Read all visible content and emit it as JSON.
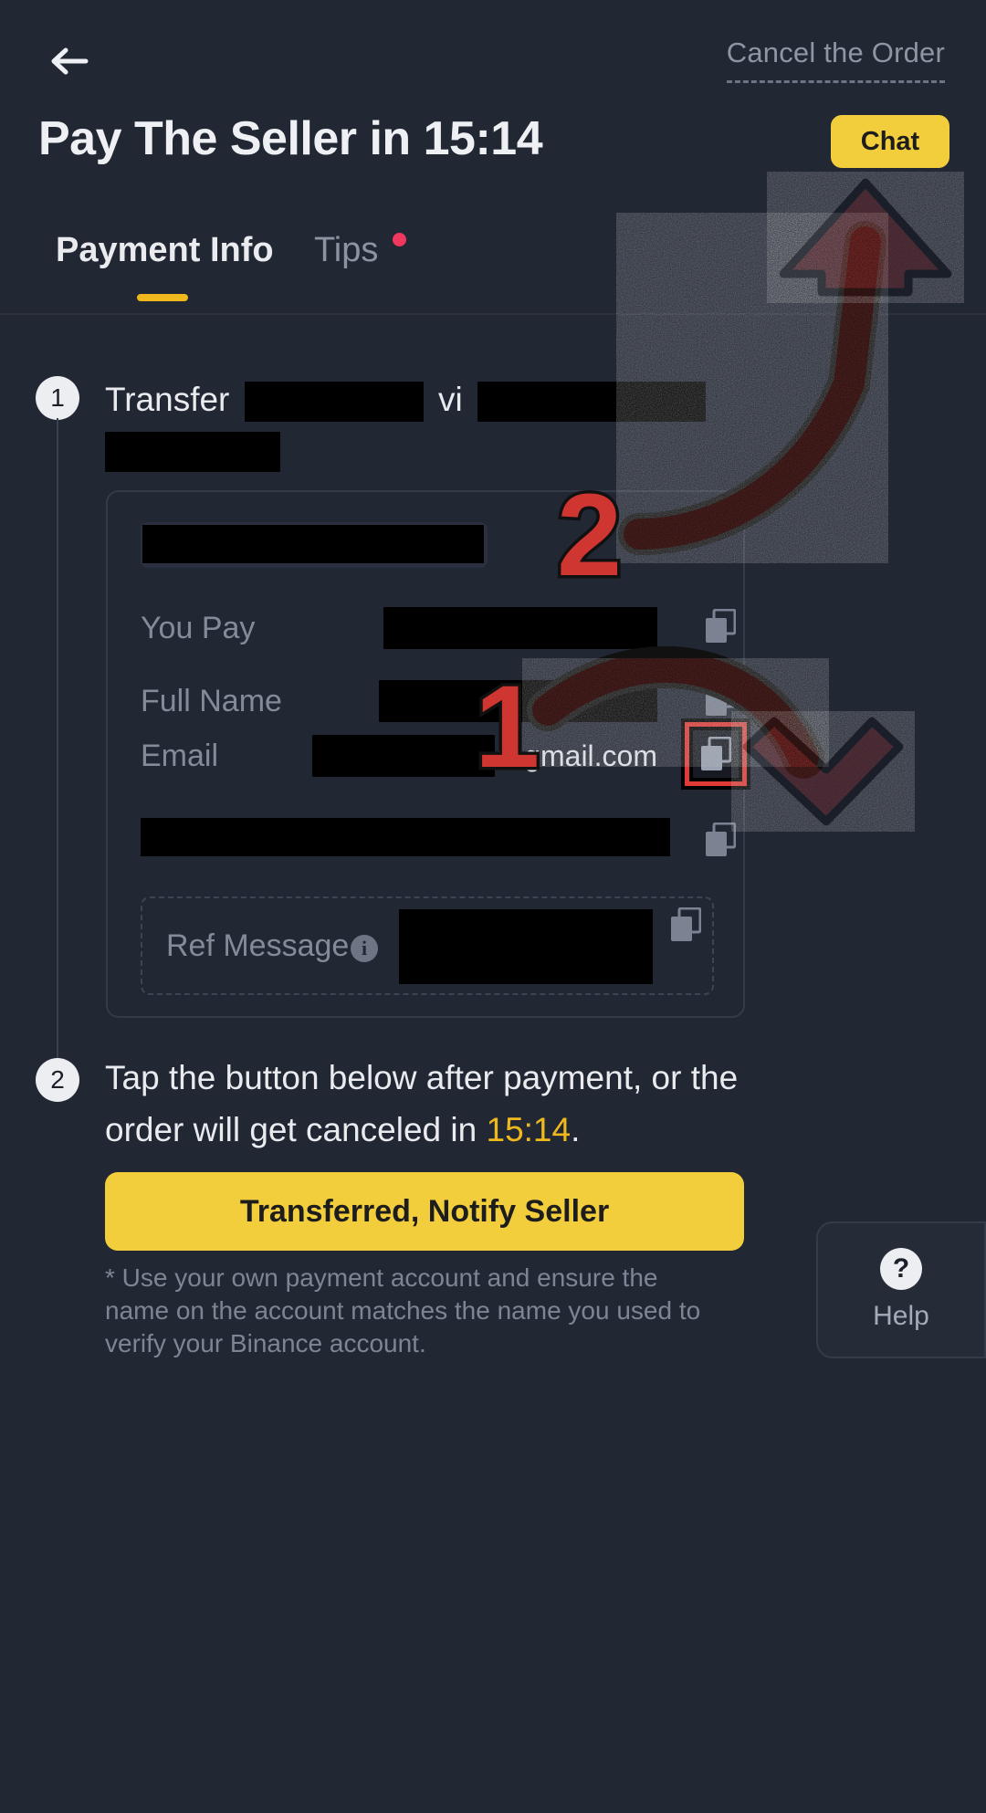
{
  "header": {
    "back_icon": "back-arrow-icon",
    "cancel_label": "Cancel the Order",
    "title": "Pay The Seller in 15:14",
    "chat_label": "Chat"
  },
  "tabs": [
    {
      "label": "Payment Info",
      "active": true
    },
    {
      "label": "Tips",
      "active": false,
      "badge": "dot"
    }
  ],
  "steps": {
    "step1": {
      "number": "1",
      "prefix": "Transfer",
      "middle": "vi",
      "redacted": true
    },
    "step2": {
      "number": "2",
      "text_before": "Tap the button below after payment, or the order will get canceled in ",
      "timer": "15:14",
      "text_after": "."
    }
  },
  "payment_card": {
    "method_badge_redacted": true,
    "rows": [
      {
        "label": "You Pay",
        "value": "",
        "redacted": true,
        "copyable": true
      },
      {
        "label": "Full Name",
        "value": "",
        "redacted": true,
        "copyable": true
      },
      {
        "label": "Email",
        "value": "",
        "suffix": "@gmail.com",
        "redacted": true,
        "copyable": true,
        "highlighted": true
      }
    ],
    "account_row": {
      "value": "",
      "redacted": true,
      "copyable": true
    },
    "ref_message": {
      "label": "Ref Message",
      "info_glyph": "i",
      "value": "",
      "redacted": true,
      "copyable": true
    }
  },
  "actions": {
    "notify_label": "Transferred, Notify Seller"
  },
  "footer": {
    "note": "* Use your own payment account and ensure the name on the account matches the name you used to verify your Binance account."
  },
  "help": {
    "icon_glyph": "?",
    "label": "Help"
  },
  "annotations": {
    "marker_one": "1",
    "marker_two": "2",
    "color": "#cf3531"
  },
  "colors": {
    "page_bg": "#222734",
    "accent_yellow": "#f3ce3c",
    "tab_underline": "#efb81c",
    "timer_amber": "#efb81c",
    "tips_dot": "#f0385e",
    "annotation_red": "#cf3531",
    "highlight_border": "#e03a36"
  }
}
